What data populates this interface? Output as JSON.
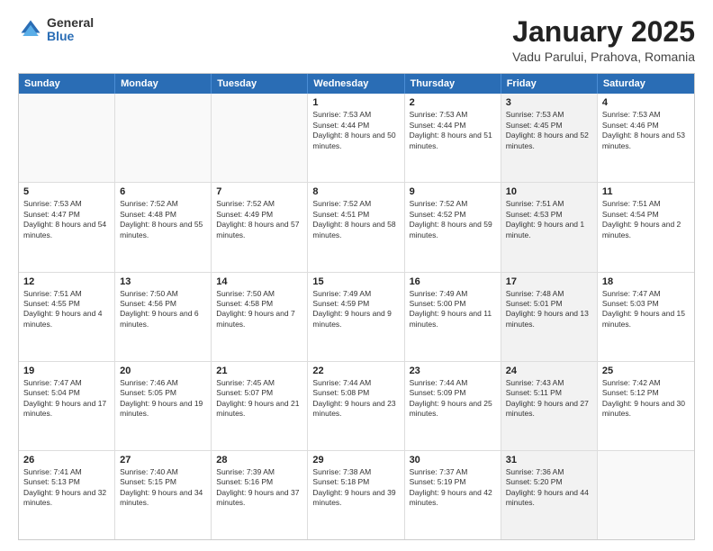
{
  "logo": {
    "general": "General",
    "blue": "Blue"
  },
  "header": {
    "title": "January 2025",
    "subtitle": "Vadu Parului, Prahova, Romania"
  },
  "weekdays": [
    "Sunday",
    "Monday",
    "Tuesday",
    "Wednesday",
    "Thursday",
    "Friday",
    "Saturday"
  ],
  "rows": [
    [
      {
        "day": "",
        "sunrise": "",
        "sunset": "",
        "daylight": "",
        "shaded": false,
        "empty": true
      },
      {
        "day": "",
        "sunrise": "",
        "sunset": "",
        "daylight": "",
        "shaded": false,
        "empty": true
      },
      {
        "day": "",
        "sunrise": "",
        "sunset": "",
        "daylight": "",
        "shaded": false,
        "empty": true
      },
      {
        "day": "1",
        "sunrise": "Sunrise: 7:53 AM",
        "sunset": "Sunset: 4:44 PM",
        "daylight": "Daylight: 8 hours and 50 minutes.",
        "shaded": false,
        "empty": false
      },
      {
        "day": "2",
        "sunrise": "Sunrise: 7:53 AM",
        "sunset": "Sunset: 4:44 PM",
        "daylight": "Daylight: 8 hours and 51 minutes.",
        "shaded": false,
        "empty": false
      },
      {
        "day": "3",
        "sunrise": "Sunrise: 7:53 AM",
        "sunset": "Sunset: 4:45 PM",
        "daylight": "Daylight: 8 hours and 52 minutes.",
        "shaded": true,
        "empty": false
      },
      {
        "day": "4",
        "sunrise": "Sunrise: 7:53 AM",
        "sunset": "Sunset: 4:46 PM",
        "daylight": "Daylight: 8 hours and 53 minutes.",
        "shaded": false,
        "empty": false
      }
    ],
    [
      {
        "day": "5",
        "sunrise": "Sunrise: 7:53 AM",
        "sunset": "Sunset: 4:47 PM",
        "daylight": "Daylight: 8 hours and 54 minutes.",
        "shaded": false,
        "empty": false
      },
      {
        "day": "6",
        "sunrise": "Sunrise: 7:52 AM",
        "sunset": "Sunset: 4:48 PM",
        "daylight": "Daylight: 8 hours and 55 minutes.",
        "shaded": false,
        "empty": false
      },
      {
        "day": "7",
        "sunrise": "Sunrise: 7:52 AM",
        "sunset": "Sunset: 4:49 PM",
        "daylight": "Daylight: 8 hours and 57 minutes.",
        "shaded": false,
        "empty": false
      },
      {
        "day": "8",
        "sunrise": "Sunrise: 7:52 AM",
        "sunset": "Sunset: 4:51 PM",
        "daylight": "Daylight: 8 hours and 58 minutes.",
        "shaded": false,
        "empty": false
      },
      {
        "day": "9",
        "sunrise": "Sunrise: 7:52 AM",
        "sunset": "Sunset: 4:52 PM",
        "daylight": "Daylight: 8 hours and 59 minutes.",
        "shaded": false,
        "empty": false
      },
      {
        "day": "10",
        "sunrise": "Sunrise: 7:51 AM",
        "sunset": "Sunset: 4:53 PM",
        "daylight": "Daylight: 9 hours and 1 minute.",
        "shaded": true,
        "empty": false
      },
      {
        "day": "11",
        "sunrise": "Sunrise: 7:51 AM",
        "sunset": "Sunset: 4:54 PM",
        "daylight": "Daylight: 9 hours and 2 minutes.",
        "shaded": false,
        "empty": false
      }
    ],
    [
      {
        "day": "12",
        "sunrise": "Sunrise: 7:51 AM",
        "sunset": "Sunset: 4:55 PM",
        "daylight": "Daylight: 9 hours and 4 minutes.",
        "shaded": false,
        "empty": false
      },
      {
        "day": "13",
        "sunrise": "Sunrise: 7:50 AM",
        "sunset": "Sunset: 4:56 PM",
        "daylight": "Daylight: 9 hours and 6 minutes.",
        "shaded": false,
        "empty": false
      },
      {
        "day": "14",
        "sunrise": "Sunrise: 7:50 AM",
        "sunset": "Sunset: 4:58 PM",
        "daylight": "Daylight: 9 hours and 7 minutes.",
        "shaded": false,
        "empty": false
      },
      {
        "day": "15",
        "sunrise": "Sunrise: 7:49 AM",
        "sunset": "Sunset: 4:59 PM",
        "daylight": "Daylight: 9 hours and 9 minutes.",
        "shaded": false,
        "empty": false
      },
      {
        "day": "16",
        "sunrise": "Sunrise: 7:49 AM",
        "sunset": "Sunset: 5:00 PM",
        "daylight": "Daylight: 9 hours and 11 minutes.",
        "shaded": false,
        "empty": false
      },
      {
        "day": "17",
        "sunrise": "Sunrise: 7:48 AM",
        "sunset": "Sunset: 5:01 PM",
        "daylight": "Daylight: 9 hours and 13 minutes.",
        "shaded": true,
        "empty": false
      },
      {
        "day": "18",
        "sunrise": "Sunrise: 7:47 AM",
        "sunset": "Sunset: 5:03 PM",
        "daylight": "Daylight: 9 hours and 15 minutes.",
        "shaded": false,
        "empty": false
      }
    ],
    [
      {
        "day": "19",
        "sunrise": "Sunrise: 7:47 AM",
        "sunset": "Sunset: 5:04 PM",
        "daylight": "Daylight: 9 hours and 17 minutes.",
        "shaded": false,
        "empty": false
      },
      {
        "day": "20",
        "sunrise": "Sunrise: 7:46 AM",
        "sunset": "Sunset: 5:05 PM",
        "daylight": "Daylight: 9 hours and 19 minutes.",
        "shaded": false,
        "empty": false
      },
      {
        "day": "21",
        "sunrise": "Sunrise: 7:45 AM",
        "sunset": "Sunset: 5:07 PM",
        "daylight": "Daylight: 9 hours and 21 minutes.",
        "shaded": false,
        "empty": false
      },
      {
        "day": "22",
        "sunrise": "Sunrise: 7:44 AM",
        "sunset": "Sunset: 5:08 PM",
        "daylight": "Daylight: 9 hours and 23 minutes.",
        "shaded": false,
        "empty": false
      },
      {
        "day": "23",
        "sunrise": "Sunrise: 7:44 AM",
        "sunset": "Sunset: 5:09 PM",
        "daylight": "Daylight: 9 hours and 25 minutes.",
        "shaded": false,
        "empty": false
      },
      {
        "day": "24",
        "sunrise": "Sunrise: 7:43 AM",
        "sunset": "Sunset: 5:11 PM",
        "daylight": "Daylight: 9 hours and 27 minutes.",
        "shaded": true,
        "empty": false
      },
      {
        "day": "25",
        "sunrise": "Sunrise: 7:42 AM",
        "sunset": "Sunset: 5:12 PM",
        "daylight": "Daylight: 9 hours and 30 minutes.",
        "shaded": false,
        "empty": false
      }
    ],
    [
      {
        "day": "26",
        "sunrise": "Sunrise: 7:41 AM",
        "sunset": "Sunset: 5:13 PM",
        "daylight": "Daylight: 9 hours and 32 minutes.",
        "shaded": false,
        "empty": false
      },
      {
        "day": "27",
        "sunrise": "Sunrise: 7:40 AM",
        "sunset": "Sunset: 5:15 PM",
        "daylight": "Daylight: 9 hours and 34 minutes.",
        "shaded": false,
        "empty": false
      },
      {
        "day": "28",
        "sunrise": "Sunrise: 7:39 AM",
        "sunset": "Sunset: 5:16 PM",
        "daylight": "Daylight: 9 hours and 37 minutes.",
        "shaded": false,
        "empty": false
      },
      {
        "day": "29",
        "sunrise": "Sunrise: 7:38 AM",
        "sunset": "Sunset: 5:18 PM",
        "daylight": "Daylight: 9 hours and 39 minutes.",
        "shaded": false,
        "empty": false
      },
      {
        "day": "30",
        "sunrise": "Sunrise: 7:37 AM",
        "sunset": "Sunset: 5:19 PM",
        "daylight": "Daylight: 9 hours and 42 minutes.",
        "shaded": false,
        "empty": false
      },
      {
        "day": "31",
        "sunrise": "Sunrise: 7:36 AM",
        "sunset": "Sunset: 5:20 PM",
        "daylight": "Daylight: 9 hours and 44 minutes.",
        "shaded": true,
        "empty": false
      },
      {
        "day": "",
        "sunrise": "",
        "sunset": "",
        "daylight": "",
        "shaded": false,
        "empty": true
      }
    ]
  ]
}
